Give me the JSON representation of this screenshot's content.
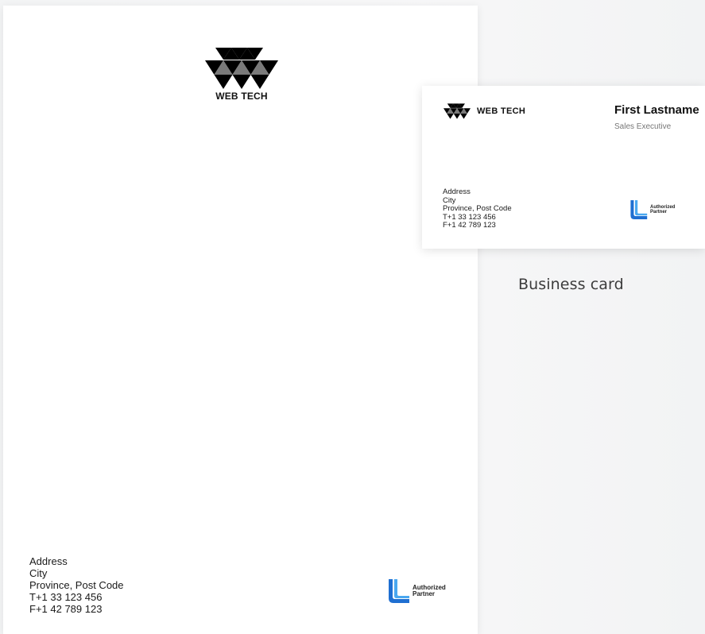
{
  "letterhead": {
    "logo_text": "WEB TECH",
    "address": {
      "line1": "Address",
      "line2": "City",
      "line3": "Province, Post Code",
      "phone": "T+1 33 123 456",
      "fax": "F+1 42 789 123"
    },
    "partner": {
      "line1": "Authorized",
      "line2": "Partner"
    }
  },
  "business_card": {
    "logo_text": "WEB TECH",
    "name": "First Lastname",
    "title": "Sales Executive",
    "address": {
      "line1": "Address",
      "line2": "City",
      "line3": "Province, Post Code",
      "phone": "T+1 33 123 456",
      "fax": "F+1 42 789 123"
    },
    "partner": {
      "line1": "Authorized",
      "line2": "Partner"
    }
  },
  "caption": "Business card",
  "colors": {
    "logo_black": "#000000",
    "logo_gray": "#8a8a8a",
    "partner_blue": "#1f6fd1",
    "partner_light_blue": "#4aa8f0"
  },
  "icons": {
    "logo": "webtech-triangles-logo",
    "partner": "authorized-partner-l-icon"
  }
}
